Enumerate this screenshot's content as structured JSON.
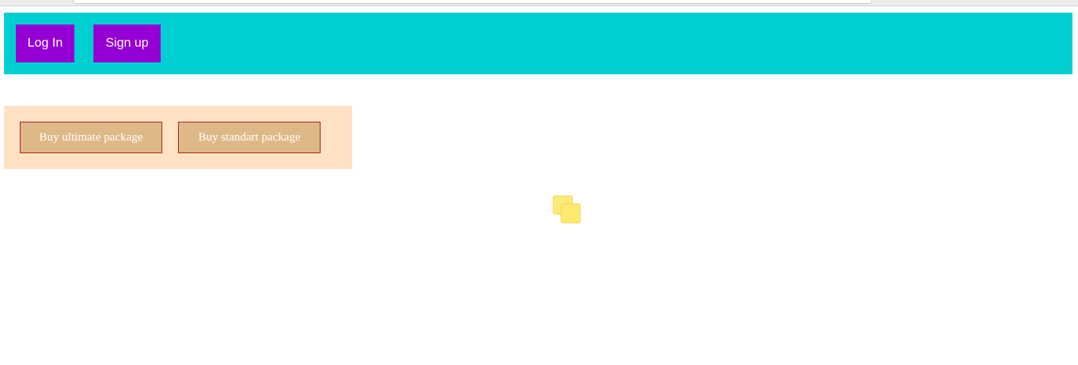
{
  "header": {
    "bg_color": "#00cfd1",
    "login_label": "Log In",
    "signup_label": "Sign up",
    "button_color": "#9400d3"
  },
  "packages": {
    "bg_color": "#fde3c3",
    "ultimate_label": "Buy ultimate package",
    "standart_label": "Buy standart package",
    "button_color": "#deb887",
    "button_border_color": "#b22222"
  },
  "icons": {
    "loader": "overlapping-squares-icon"
  }
}
